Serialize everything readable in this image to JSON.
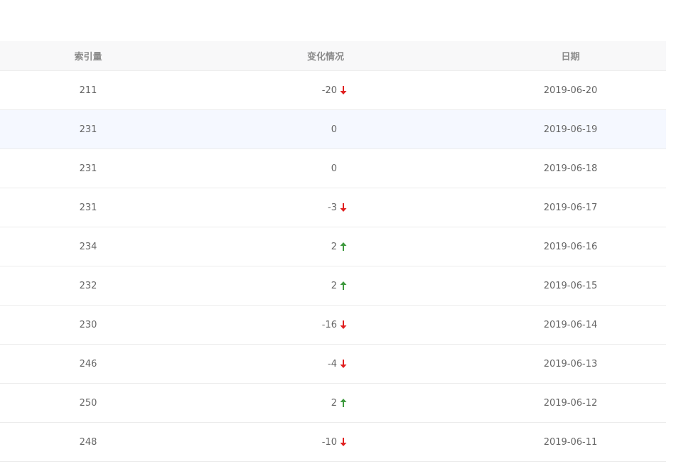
{
  "table": {
    "headers": {
      "index": "索引量",
      "change": "变化情况",
      "date": "日期"
    },
    "rows": [
      {
        "index": "211",
        "change": "-20",
        "trend": "down",
        "date": "2019-06-20"
      },
      {
        "index": "231",
        "change": "0",
        "trend": "none",
        "date": "2019-06-19"
      },
      {
        "index": "231",
        "change": "0",
        "trend": "none",
        "date": "2019-06-18"
      },
      {
        "index": "231",
        "change": "-3",
        "trend": "down",
        "date": "2019-06-17"
      },
      {
        "index": "234",
        "change": "2",
        "trend": "up",
        "date": "2019-06-16"
      },
      {
        "index": "232",
        "change": "2",
        "trend": "up",
        "date": "2019-06-15"
      },
      {
        "index": "230",
        "change": "-16",
        "trend": "down",
        "date": "2019-06-14"
      },
      {
        "index": "246",
        "change": "-4",
        "trend": "down",
        "date": "2019-06-13"
      },
      {
        "index": "250",
        "change": "2",
        "trend": "up",
        "date": "2019-06-12"
      },
      {
        "index": "248",
        "change": "-10",
        "trend": "down",
        "date": "2019-06-11"
      }
    ]
  },
  "colors": {
    "up": "#3f9a3f",
    "down": "#e02020",
    "hover_row": "#f5f8ff",
    "header_bg": "#f8f8f9"
  },
  "icons": {
    "up": "arrow-up-icon",
    "down": "arrow-down-icon"
  }
}
